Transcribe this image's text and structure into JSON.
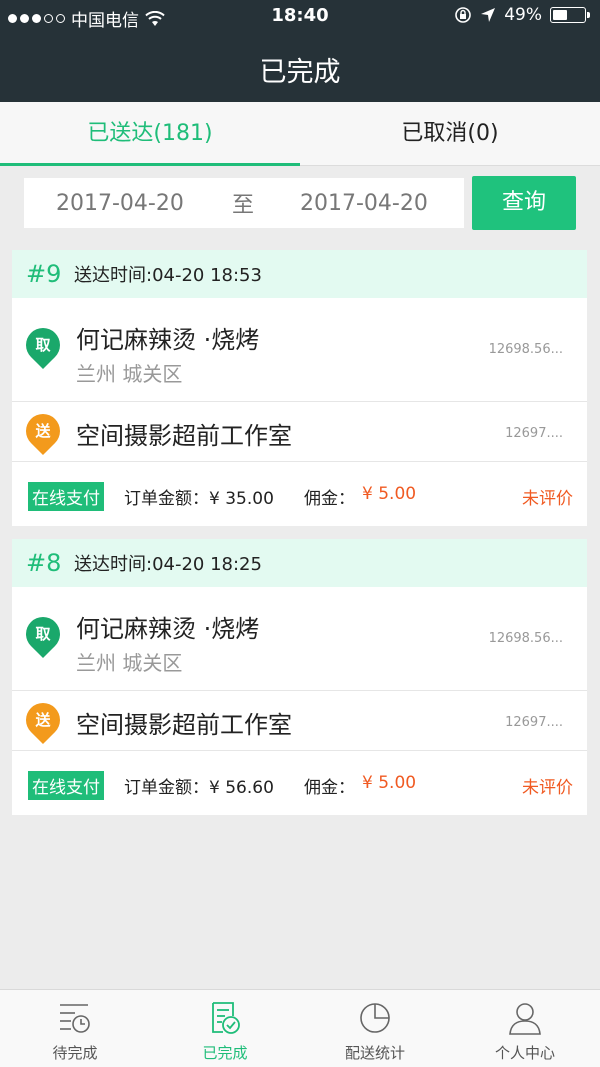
{
  "status_bar": {
    "carrier": "中国电信",
    "time": "18:40",
    "battery": "49%",
    "battery_level": 0.49
  },
  "nav": {
    "title": "已完成"
  },
  "tabs": [
    {
      "label": "已送达(181)",
      "active": true
    },
    {
      "label": "已取消(0)",
      "active": false
    }
  ],
  "filter": {
    "start_date": "2017-04-20",
    "separator": "至",
    "end_date": "2017-04-20",
    "query_label": "查询"
  },
  "orders": [
    {
      "number": "#9",
      "delivered_time": "送达时间:04-20 18:53",
      "pickup": {
        "tag": "取",
        "name": "何记麻辣烫 ·烧烤",
        "area": "兰州 城关区",
        "distance": "12698.56..."
      },
      "dropoff": {
        "tag": "送",
        "name": "空间摄影超前工作室",
        "distance": "12697...."
      },
      "payment": "在线支付",
      "amount": "订单金额：¥ 35.00",
      "fee_label": "佣金：",
      "fee": "¥ 5.00",
      "review": "未评价"
    },
    {
      "number": "#8",
      "delivered_time": "送达时间:04-20 18:25",
      "pickup": {
        "tag": "取",
        "name": "何记麻辣烫 ·烧烤",
        "area": "兰州 城关区",
        "distance": "12698.56..."
      },
      "dropoff": {
        "tag": "送",
        "name": "空间摄影超前工作室",
        "distance": "12697...."
      },
      "payment": "在线支付",
      "amount": "订单金额：¥ 56.60",
      "fee_label": "佣金：",
      "fee": "¥ 5.00",
      "review": "未评价"
    }
  ],
  "tabbar": [
    {
      "label": "待完成",
      "icon": "pending-list-icon",
      "active": false
    },
    {
      "label": "已完成",
      "icon": "completed-list-icon",
      "active": true
    },
    {
      "label": "配送统计",
      "icon": "pie-chart-icon",
      "active": false
    },
    {
      "label": "个人中心",
      "icon": "user-icon",
      "active": false
    }
  ],
  "colors": {
    "accent": "#1fbd79",
    "header": "#263238",
    "highlight": "#f05a22",
    "pickup_pin": "#1aa86b",
    "dropoff_pin": "#f39a1c"
  }
}
